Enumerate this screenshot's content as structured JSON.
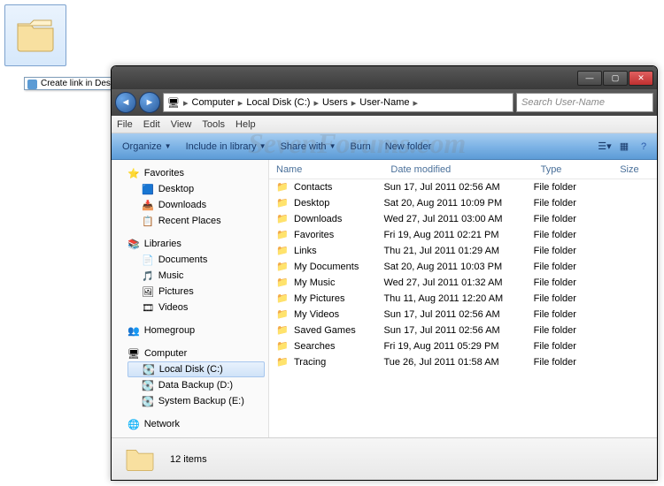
{
  "desktop": {
    "drag_tooltip": "Create link in Desktop"
  },
  "window": {
    "breadcrumbs": [
      "Computer",
      "Local Disk (C:)",
      "Users",
      "User-Name"
    ],
    "search_placeholder": "Search User-Name",
    "menu": {
      "file": "File",
      "edit": "Edit",
      "view": "View",
      "tools": "Tools",
      "help": "Help"
    },
    "toolbar": {
      "organize": "Organize",
      "include": "Include in library",
      "share": "Share with",
      "burn": "Burn",
      "newfolder": "New folder"
    },
    "nav": {
      "favorites": {
        "head": "Favorites",
        "desktop": "Desktop",
        "downloads": "Downloads",
        "recent": "Recent Places"
      },
      "libraries": {
        "head": "Libraries",
        "documents": "Documents",
        "music": "Music",
        "pictures": "Pictures",
        "videos": "Videos"
      },
      "homegroup": "Homegroup",
      "computer": {
        "head": "Computer",
        "c": "Local Disk (C:)",
        "d": "Data Backup (D:)",
        "e": "System Backup (E:)"
      },
      "network": "Network"
    },
    "columns": {
      "name": "Name",
      "date": "Date modified",
      "type": "Type",
      "size": "Size"
    },
    "rows": [
      {
        "name": "Contacts",
        "date": "Sun 17, Jul 2011 02:56 AM",
        "type": "File folder"
      },
      {
        "name": "Desktop",
        "date": "Sat 20, Aug 2011 10:09 PM",
        "type": "File folder"
      },
      {
        "name": "Downloads",
        "date": "Wed 27, Jul 2011 03:00 AM",
        "type": "File folder"
      },
      {
        "name": "Favorites",
        "date": "Fri 19, Aug 2011 02:21 PM",
        "type": "File folder"
      },
      {
        "name": "Links",
        "date": "Thu 21, Jul 2011 01:29 AM",
        "type": "File folder"
      },
      {
        "name": "My Documents",
        "date": "Sat 20, Aug 2011 10:03 PM",
        "type": "File folder"
      },
      {
        "name": "My Music",
        "date": "Wed 27, Jul 2011 01:32 AM",
        "type": "File folder"
      },
      {
        "name": "My Pictures",
        "date": "Thu 11, Aug 2011 12:20 AM",
        "type": "File folder"
      },
      {
        "name": "My Videos",
        "date": "Sun 17, Jul 2011 02:56 AM",
        "type": "File folder"
      },
      {
        "name": "Saved Games",
        "date": "Sun 17, Jul 2011 02:56 AM",
        "type": "File folder"
      },
      {
        "name": "Searches",
        "date": "Fri 19, Aug 2011 05:29 PM",
        "type": "File folder"
      },
      {
        "name": "Tracing",
        "date": "Tue 26, Jul 2011 01:58 AM",
        "type": "File folder"
      }
    ],
    "status": "12 items"
  },
  "watermark": "SevenForums.com"
}
